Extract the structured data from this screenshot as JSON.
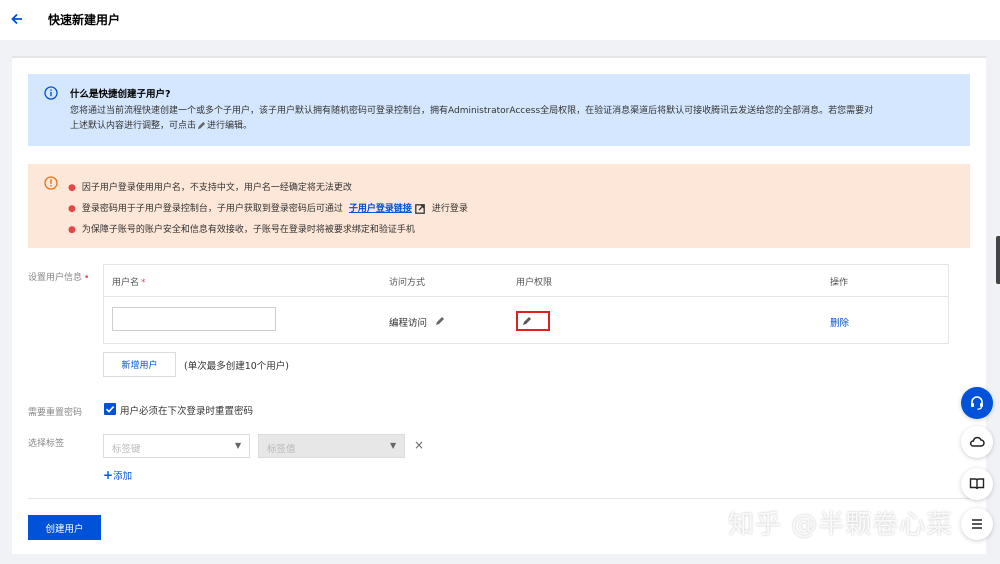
{
  "header": {
    "title": "快速新建用户"
  },
  "info": {
    "title": "什么是快捷创建子用户?",
    "line1": "您将通过当前流程快速创建一个或多个子用户，该子用户默认拥有随机密码可登录控制台，拥有AdministratorAccess全局权限，在验证消息渠道后将默认可接收腾讯云发送给您的全部消息。若您需要对",
    "line2_before": "上述默认内容进行调整，可点击",
    "line2_after": "进行编辑。"
  },
  "notice": {
    "item1": "因子用户登录使用用户名，不支持中文，用户名一经确定将无法更改",
    "item2_before": "登录密码用于子用户登录控制台，子用户获取到登录密码后可通过",
    "item2_link": "子用户登录链接",
    "item2_after": "进行登录",
    "item3": "为保障子账号的账户安全和信息有效接收，子账号在登录时将被要求绑定和验证手机"
  },
  "user_info": {
    "label": "设置用户信息",
    "required_mark": "•",
    "columns": {
      "username": "用户名",
      "username_required": "*",
      "access": "访问方式",
      "permission": "用户权限",
      "actions": "操作"
    },
    "row": {
      "username_value": "",
      "access_value": "编程访问",
      "delete_label": "删除"
    },
    "add_user_label": "新增用户",
    "add_hint": "(单次最多创建10个用户)"
  },
  "reset_password": {
    "label": "需要重置密码",
    "checkbox_label": "用户必须在下次登录时重置密码",
    "checked": true
  },
  "tags": {
    "label": "选择标签",
    "key_placeholder": "标签键",
    "value_placeholder": "标签值",
    "add_label": "添加",
    "add_plus": "+",
    "remove_symbol": "×"
  },
  "footer": {
    "create_label": "创建用户"
  },
  "watermark": "知乎 @半颗卷心菜",
  "colors": {
    "primary": "#0052d9",
    "info_bg": "#d5e7fe",
    "warning_bg": "#fde7d8",
    "warning_icon": "#e37318",
    "danger": "#e54545",
    "highlight_border": "#e0201c"
  },
  "icons": {
    "back": "arrow-left-icon",
    "info": "info-circle-icon",
    "warning": "warning-circle-icon",
    "edit": "pencil-icon",
    "external": "external-link-icon",
    "support": "headset-icon",
    "cloud": "cloud-icon",
    "docs": "book-icon",
    "menu": "list-icon"
  }
}
